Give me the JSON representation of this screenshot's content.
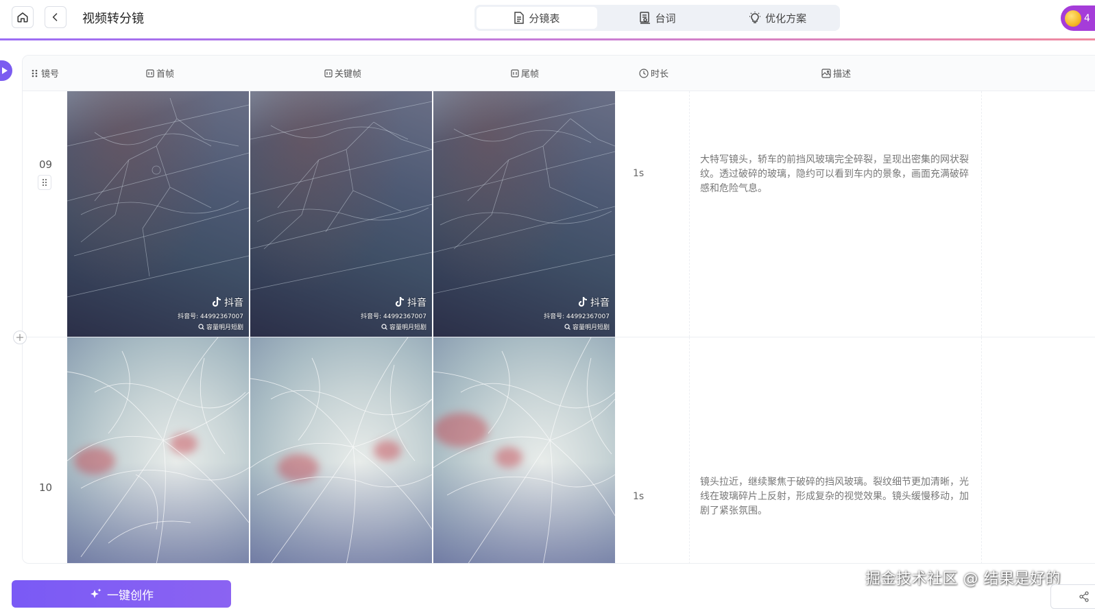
{
  "header": {
    "title": "视频转分镜",
    "tabs": [
      {
        "label": "分镜表",
        "active": true,
        "icon": "document-icon"
      },
      {
        "label": "台词",
        "active": false,
        "icon": "script-icon"
      },
      {
        "label": "优化方案",
        "active": false,
        "icon": "lightbulb-icon"
      }
    ],
    "credits": "4",
    "accent_color": "#7b5cf0"
  },
  "table": {
    "columns": [
      {
        "label": "镜号",
        "icon": "drag-dots-icon"
      },
      {
        "label": "首帧",
        "icon": "frame-icon"
      },
      {
        "label": "关键帧",
        "icon": "frame-icon"
      },
      {
        "label": "尾帧",
        "icon": "frame-icon"
      },
      {
        "label": "时长",
        "icon": "clock-icon"
      },
      {
        "label": "描述",
        "icon": "image-text-icon"
      }
    ],
    "rows": [
      {
        "shot_no": "09",
        "duration": "1s",
        "description": "大特写镜头，轿车的前挡风玻璃完全碎裂，呈现出密集的网状裂纹。透过破碎的玻璃，隐约可以看到车内的景象，画面充满破碎感和危险气息。",
        "watermark": {
          "logo": "抖音",
          "id": "抖音号: 44992367007",
          "search": "容量明月短剧"
        }
      },
      {
        "shot_no": "10",
        "duration": "1s",
        "description": "镜头拉近，继续聚焦于破碎的挡风玻璃。裂纹细节更加清晰，光线在玻璃碎片上反射，形成复杂的视觉效果。镜头缓慢移动，加剧了紧张氛围。"
      }
    ]
  },
  "footer": {
    "create_button": "一键创作",
    "watermark": "掘金技术社区 @ 结果是好的"
  }
}
